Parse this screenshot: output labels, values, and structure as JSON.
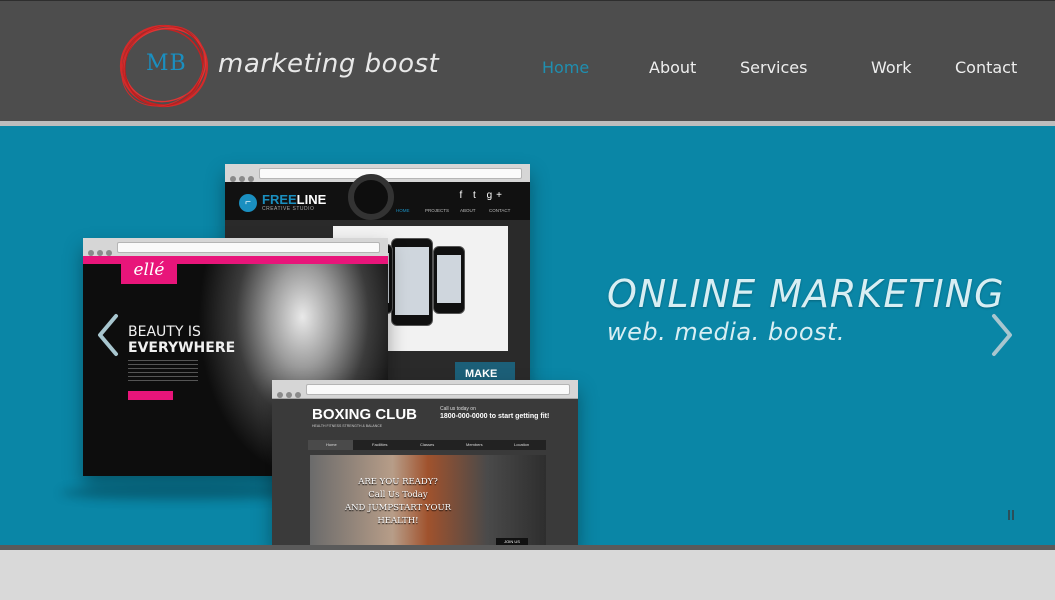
{
  "brand": {
    "initials": "MB",
    "name": "marketing boost"
  },
  "nav": [
    {
      "label": "Home",
      "active": true
    },
    {
      "label": "About",
      "active": false
    },
    {
      "label": "Services",
      "active": false
    },
    {
      "label": "Work",
      "active": false
    },
    {
      "label": "Contact",
      "active": false
    }
  ],
  "hero": {
    "title": "ONLINE MARKETING",
    "subtitle": "web. media. boost."
  },
  "mockups": {
    "freeline": {
      "brand_a": "FREE",
      "brand_b": "LINE",
      "brand_sub": "CREATIVE STUDIO",
      "social": "f t g+",
      "nav": [
        "HOME",
        "PROJECTS",
        "ABOUT",
        "CONTACT"
      ],
      "cta": "MAKE"
    },
    "elle": {
      "logo": "ellé",
      "headline_1": "BEAUTY IS",
      "headline_2": "EVERYWHERE"
    },
    "boxing": {
      "title": "BOXING CLUB",
      "tagline": "HEALTH FITNESS STRENGTH & BALANCE",
      "call_label": "Call us today on",
      "call_text": "1800-000-0000 to start getting fit!",
      "nav": [
        "Home",
        "Facilities",
        "Classes",
        "Members",
        "Location"
      ],
      "callout_1": "ARE YOU READY?",
      "callout_2": "Call Us Today",
      "callout_3": "AND JUMPSTART YOUR HEALTH!",
      "join": "JOIN US"
    }
  },
  "colors": {
    "header_bg": "#4d4d4d",
    "hero_bg": "#0a86a6",
    "accent": "#1f8fb0",
    "logo_ring": "#d42a2a",
    "pink": "#e8157a"
  }
}
